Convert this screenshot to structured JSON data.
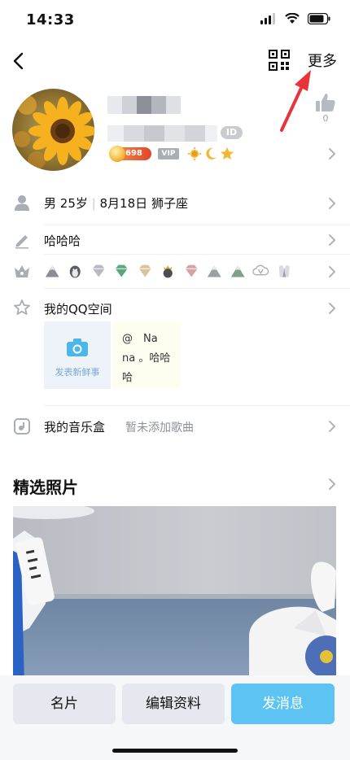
{
  "status_bar": {
    "time": "14:33"
  },
  "nav": {
    "more_label": "更多"
  },
  "profile": {
    "id_badge": "ID",
    "coin_value": "698",
    "vip_label": "VIP",
    "likes": "0"
  },
  "info_rows": {
    "gender": "男",
    "age": "25岁",
    "birthday": "8月18日",
    "zodiac": "狮子座",
    "signature": "哈哈哈"
  },
  "qzone": {
    "title": "我的QQ空间",
    "camera_label": "发表新鲜事",
    "post_lines": [
      "@　Na",
      "na 。哈哈",
      "哈"
    ]
  },
  "music": {
    "title": "我的音乐盒",
    "empty_text": "暂未添加歌曲"
  },
  "photos": {
    "title": "精选照片"
  },
  "actions": {
    "card": "名片",
    "edit": "编辑资料",
    "message": "发消息"
  },
  "colors": {
    "accent": "#5cc3f2",
    "arrow": "#e8333a"
  }
}
